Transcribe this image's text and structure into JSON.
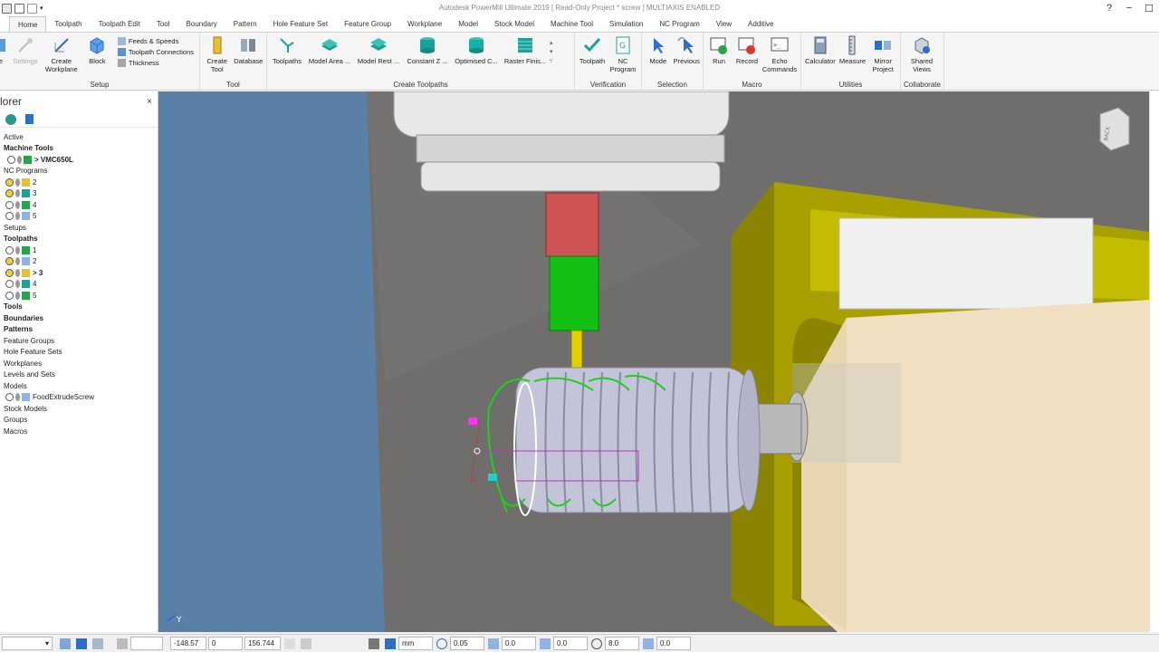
{
  "window": {
    "title": "Autodesk PowerMill Ultimate 2019   [ Read-Only Project * screw ]   MULTIAXIS ENABLED"
  },
  "tabs": [
    "Home",
    "Toolpath",
    "Toolpath Edit",
    "Tool",
    "Boundary",
    "Pattern",
    "Hole Feature Set",
    "Feature Group",
    "Workplane",
    "Model",
    "Stock Model",
    "Machine Tool",
    "Simulation",
    "NC Program",
    "View",
    "Additive"
  ],
  "ribbon": {
    "setup": {
      "label": "Setup",
      "buttons": [
        "ate",
        "Settings",
        "Create Workplane",
        "Block"
      ],
      "small": [
        "Feeds & Speeds",
        "Toolpath Connections",
        "Thickness"
      ]
    },
    "tool": {
      "label": "Tool",
      "buttons": [
        "Create Tool",
        "Database"
      ]
    },
    "create_toolpaths": {
      "label": "Create Toolpaths",
      "buttons": [
        "Toolpaths",
        "Model Area ...",
        "Model Rest ...",
        "Constant Z ...",
        "Optimised C...",
        "Raster Finis..."
      ]
    },
    "verification": {
      "label": "Verification",
      "buttons": [
        "Toolpath",
        "NC Program"
      ]
    },
    "selection": {
      "label": "Selection",
      "buttons": [
        "Mode",
        "Previous"
      ]
    },
    "macro": {
      "label": "Macro",
      "buttons": [
        "Run",
        "Record",
        "Echo Commands"
      ]
    },
    "utilities": {
      "label": "Utilities",
      "buttons": [
        "Calculator",
        "Measure",
        "Mirror Project"
      ]
    },
    "collaborate": {
      "label": "Collaborate",
      "buttons": [
        "Shared Views"
      ]
    }
  },
  "explorer": {
    "title": "lorer",
    "items": [
      {
        "text": "Active",
        "bold": false,
        "indent": 0
      },
      {
        "text": "Machine Tools",
        "bold": true,
        "indent": 0
      },
      {
        "text": "> VMC650L",
        "bold": true,
        "indent": 2
      },
      {
        "text": "NC Programs",
        "bold": false,
        "indent": 0
      },
      {
        "text": "2",
        "bold": false,
        "indent": 1
      },
      {
        "text": "3",
        "bold": false,
        "indent": 1
      },
      {
        "text": "4",
        "bold": false,
        "indent": 1
      },
      {
        "text": "5",
        "bold": false,
        "indent": 1
      },
      {
        "text": "Setups",
        "bold": false,
        "indent": 0
      },
      {
        "text": "Toolpaths",
        "bold": true,
        "indent": 0
      },
      {
        "text": "1",
        "bold": false,
        "indent": 1
      },
      {
        "text": "2",
        "bold": false,
        "indent": 1
      },
      {
        "text": "> 3",
        "bold": true,
        "indent": 1
      },
      {
        "text": "4",
        "bold": false,
        "indent": 1
      },
      {
        "text": "5",
        "bold": false,
        "indent": 1
      },
      {
        "text": "Tools",
        "bold": true,
        "indent": 0
      },
      {
        "text": "Boundaries",
        "bold": true,
        "indent": 0
      },
      {
        "text": "Patterns",
        "bold": true,
        "indent": 0
      },
      {
        "text": "Feature Groups",
        "bold": false,
        "indent": 0
      },
      {
        "text": "Hole Feature Sets",
        "bold": false,
        "indent": 0
      },
      {
        "text": "Workplanes",
        "bold": false,
        "indent": 0
      },
      {
        "text": "Levels and Sets",
        "bold": false,
        "indent": 0
      },
      {
        "text": "Models",
        "bold": false,
        "indent": 0
      },
      {
        "text": "FoodExtrudeScrew",
        "bold": false,
        "indent": 1
      },
      {
        "text": "Stock Models",
        "bold": false,
        "indent": 0
      },
      {
        "text": "Groups",
        "bold": false,
        "indent": 0
      },
      {
        "text": "Macros",
        "bold": false,
        "indent": 0
      }
    ]
  },
  "viewport": {
    "view_cube_label": "BACK",
    "axis_label": "Y"
  },
  "status": {
    "x": "-148.57",
    "y": "0",
    "z": "156.744",
    "units": "mm",
    "tolerance": "0.05",
    "stock": "0.0",
    "thickness": "0.0",
    "diameter": "8.0",
    "angle": "0.0"
  }
}
